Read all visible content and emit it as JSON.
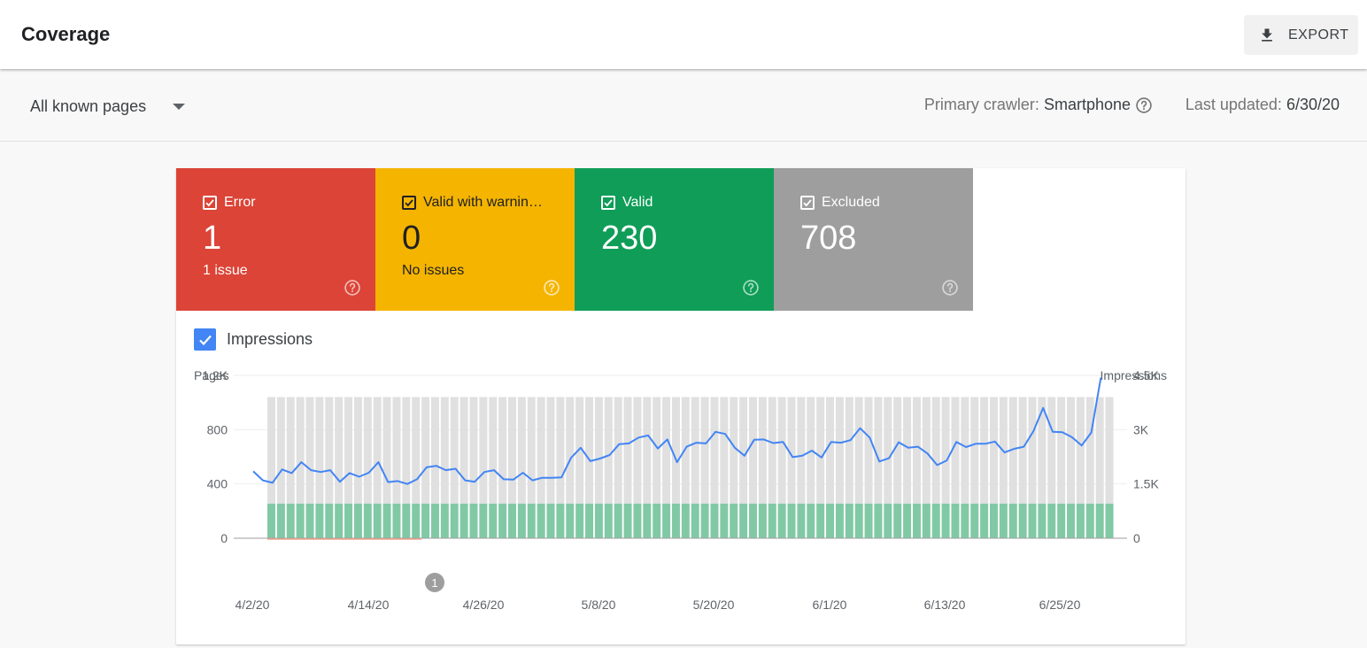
{
  "header": {
    "title": "Coverage",
    "export_label": "EXPORT"
  },
  "filter": {
    "pages_select": "All known pages",
    "crawler_label": "Primary crawler:",
    "crawler_value": "Smartphone",
    "updated_label": "Last updated:",
    "updated_value": "6/30/20"
  },
  "tiles": {
    "error": {
      "label": "Error",
      "value": "1",
      "sub": "1 issue",
      "color": "#db4437"
    },
    "warning": {
      "label": "Valid with warnin…",
      "value": "0",
      "sub": "No issues",
      "color": "#f4b400"
    },
    "valid": {
      "label": "Valid",
      "value": "230",
      "sub": "",
      "color": "#0f9d58"
    },
    "excluded": {
      "label": "Excluded",
      "value": "708",
      "sub": "",
      "color": "#9e9e9e"
    }
  },
  "impressions_toggle": {
    "label": "Impressions",
    "checked": true
  },
  "chart_data": {
    "type": "bar",
    "left_axis_title": "Pages",
    "right_axis_title": "Impressions",
    "left_ticks": [
      "1.2K",
      "800",
      "400",
      "0"
    ],
    "right_ticks": [
      "4.5K",
      "3K",
      "1.5K",
      "0"
    ],
    "ylim_pages": [
      0,
      1200
    ],
    "ylim_impressions": [
      0,
      4500
    ],
    "x_tick_labels": [
      "4/2/20",
      "4/14/20",
      "4/26/20",
      "5/8/20",
      "5/20/20",
      "6/1/20",
      "6/13/20",
      "6/25/20"
    ],
    "annotation": {
      "label": "1",
      "date": "4/20/20"
    },
    "first_bar_date": "4/3/20",
    "series": [
      {
        "name": "Valid",
        "color": "#81c9a5",
        "values": [
          255,
          255,
          255,
          255,
          255,
          255,
          255,
          255,
          255,
          255,
          255,
          255,
          255,
          255,
          255,
          255,
          255,
          255,
          255,
          255,
          255,
          255,
          255,
          255,
          255,
          255,
          255,
          255,
          255,
          255,
          255,
          255,
          255,
          255,
          255,
          255,
          255,
          255,
          255,
          255,
          255,
          255,
          255,
          255,
          255,
          255,
          255,
          255,
          255,
          255,
          255,
          255,
          255,
          255,
          255,
          255,
          255,
          255,
          255,
          255,
          255,
          255,
          255,
          255,
          255,
          255,
          255,
          255,
          255,
          255,
          255,
          255,
          255,
          255,
          255,
          255,
          255,
          255,
          255,
          255,
          255,
          255,
          255,
          255,
          255,
          255,
          255,
          255
        ]
      },
      {
        "name": "Excluded",
        "color": "#e0e0e0",
        "values": [
          1040,
          1040,
          1040,
          1040,
          1040,
          1040,
          1040,
          1040,
          1040,
          1040,
          1040,
          1040,
          1040,
          1040,
          1040,
          1040,
          1040,
          1040,
          1040,
          1040,
          1040,
          1040,
          1040,
          1040,
          1040,
          1040,
          1040,
          1040,
          1040,
          1040,
          1040,
          1040,
          1040,
          1040,
          1040,
          1040,
          1040,
          1040,
          1040,
          1040,
          1040,
          1040,
          1040,
          1040,
          1040,
          1040,
          1040,
          1040,
          1040,
          1040,
          1040,
          1040,
          1040,
          1040,
          1040,
          1040,
          1040,
          1040,
          1040,
          1040,
          1040,
          1040,
          1040,
          1040,
          1040,
          1040,
          1040,
          1040,
          1040,
          1040,
          1040,
          1040,
          1040,
          1040,
          1040,
          1040,
          1040,
          1040,
          1040,
          1040,
          1040,
          1040,
          1040,
          1040,
          1040,
          1040,
          1040,
          1040
        ]
      },
      {
        "name": "Impressions",
        "color": "#4285f4",
        "values": [
          1850,
          1600,
          1530,
          1900,
          1800,
          2100,
          1880,
          1830,
          1880,
          1560,
          1800,
          1700,
          1810,
          2100,
          1550,
          1580,
          1500,
          1630,
          1960,
          2000,
          1880,
          1920,
          1600,
          1560,
          1830,
          1880,
          1630,
          1620,
          1810,
          1600,
          1670,
          1670,
          1680,
          2220,
          2500,
          2130,
          2200,
          2300,
          2600,
          2620,
          2780,
          2840,
          2480,
          2730,
          2100,
          2530,
          2640,
          2620,
          2940,
          2880,
          2500,
          2280,
          2720,
          2730,
          2630,
          2660,
          2240,
          2280,
          2420,
          2230,
          2660,
          2640,
          2710,
          3040,
          2780,
          2120,
          2210,
          2650,
          2500,
          2530,
          2340,
          2020,
          2150,
          2660,
          2520,
          2610,
          2610,
          2670,
          2370,
          2470,
          2530,
          2960,
          3600,
          2940,
          2930,
          2790,
          2560,
          2920,
          4440
        ]
      }
    ]
  }
}
